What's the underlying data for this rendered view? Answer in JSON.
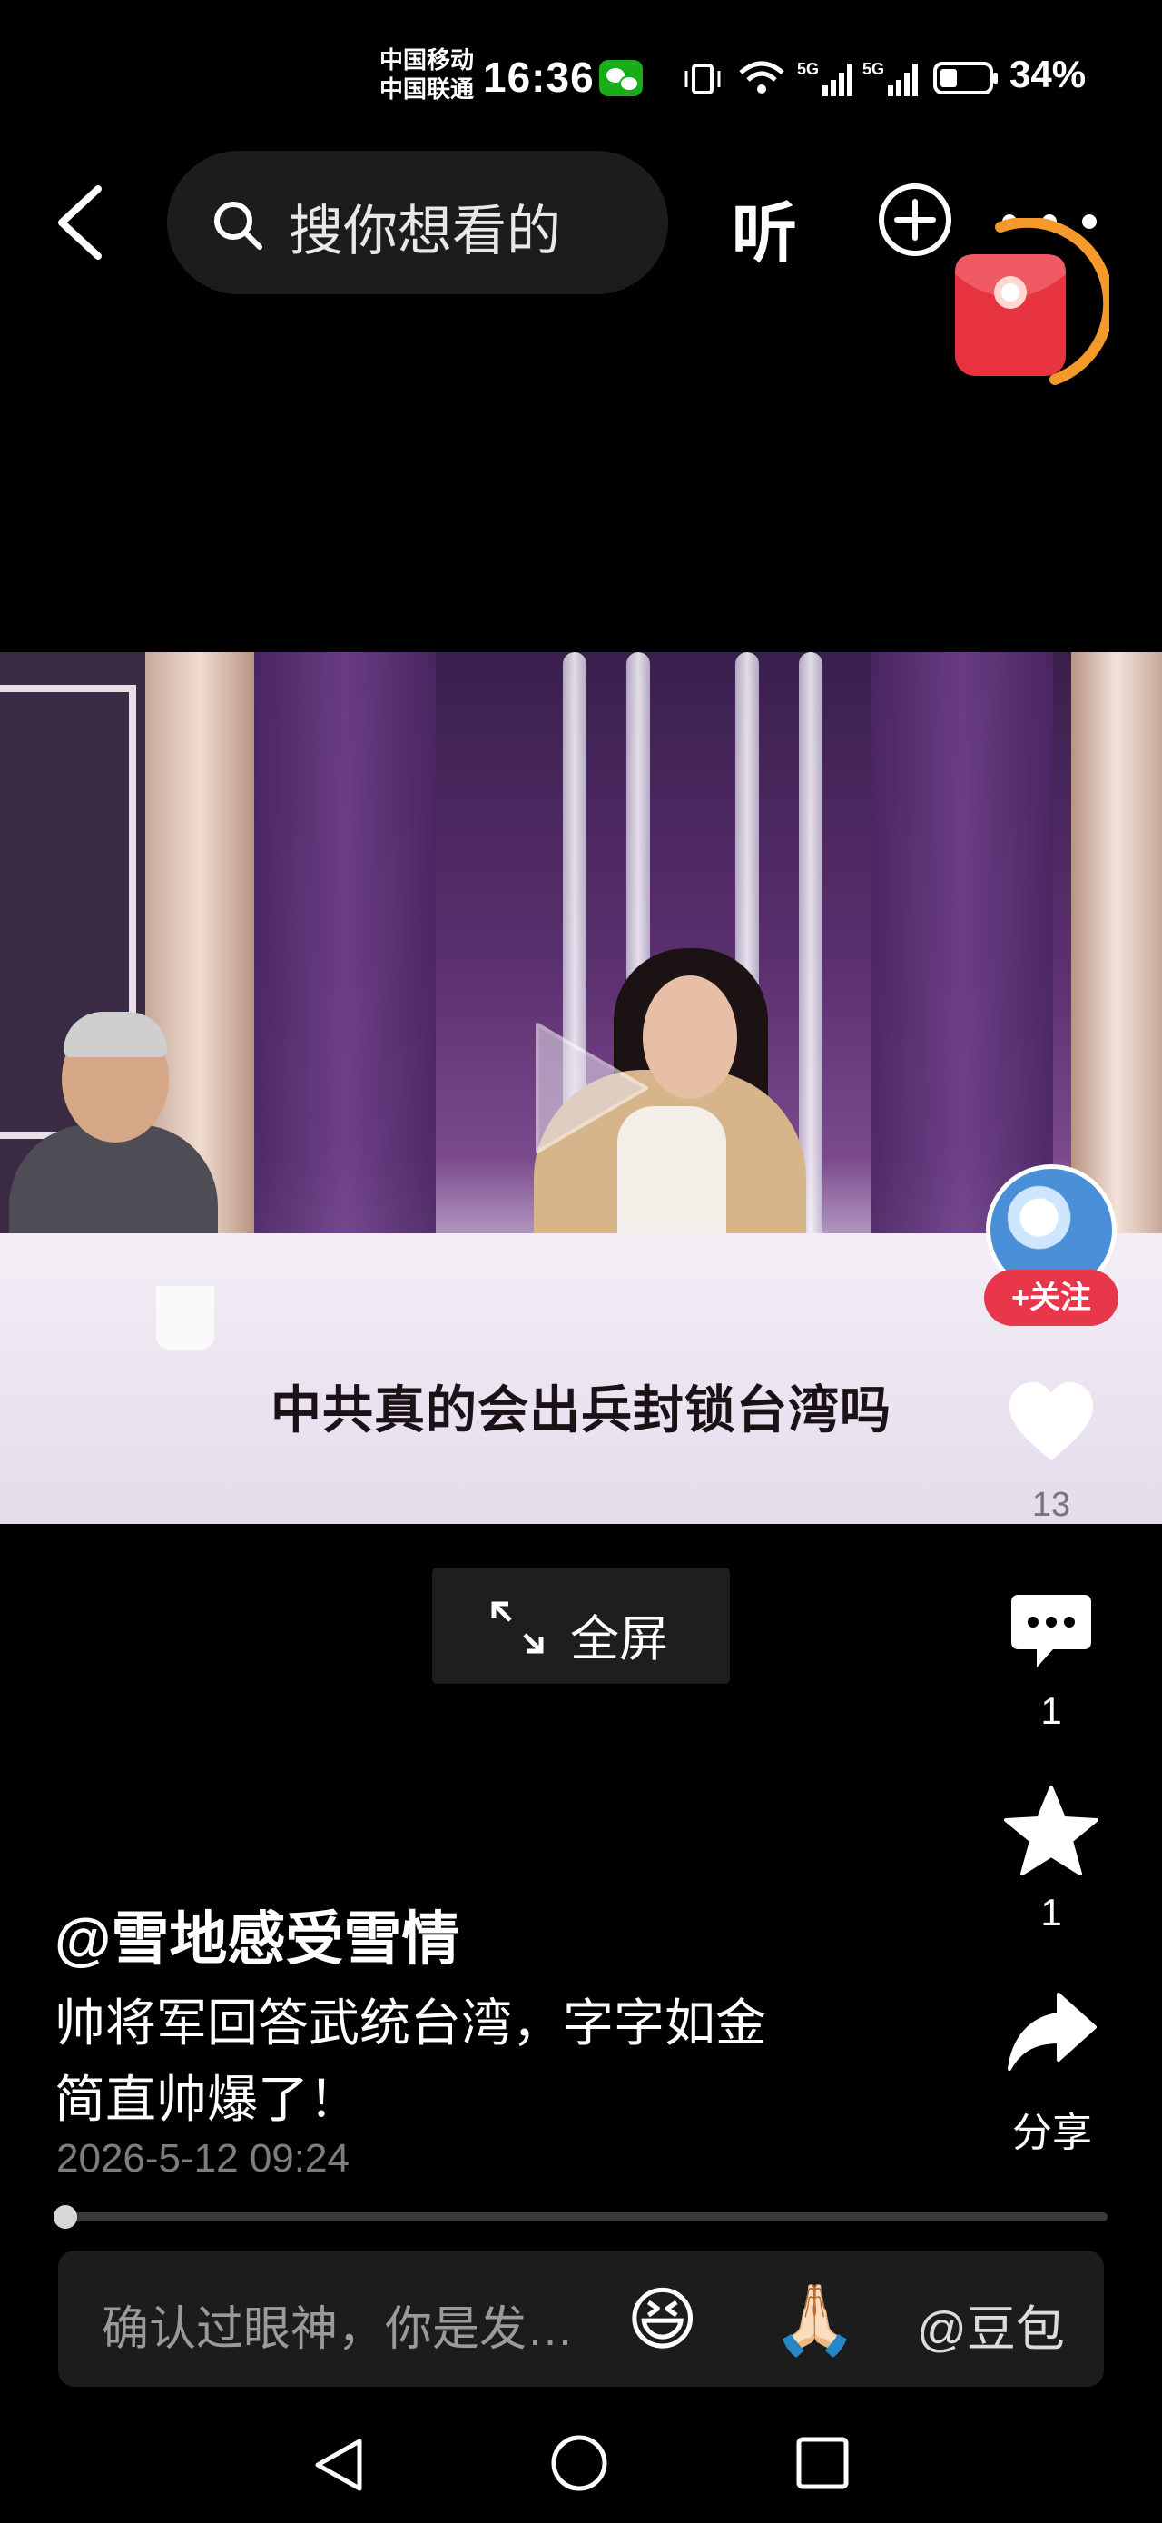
{
  "status_bar": {
    "carrier1": "中国移动",
    "carrier2": "中国联通",
    "time": "16:36",
    "battery": "34%",
    "signal_1": "5G",
    "signal_2": "5G"
  },
  "top_nav": {
    "search_placeholder": "搜你想看的",
    "listen_label": "听"
  },
  "video": {
    "subtitle": "中共真的会出兵封锁台湾吗"
  },
  "fullscreen_label": "全屏",
  "actions": {
    "follow_label": "+关注",
    "like_count": "13",
    "comment_count": "1",
    "favorite_count": "1",
    "share_label": "分享"
  },
  "post": {
    "author": "@雪地感受雪情",
    "description_line1": "帅将军回答武统台湾，字字如金",
    "description_line2": "简直帅爆了！",
    "date": "2026-5-12 09:24",
    "progress_fraction": 0.01
  },
  "comment_bar": {
    "placeholder": "确认过眼神，你是发…",
    "emoji_1": "😆",
    "emoji_2": "🙏🏻",
    "mention": "@豆包"
  },
  "icons": {
    "back": "back-arrow-icon",
    "search": "search-icon",
    "add": "plus-circle-icon",
    "more": "more-dots-icon",
    "red_packet": "red-packet-icon",
    "like": "heart-icon",
    "comment": "comment-bubble-icon",
    "favorite": "star-icon",
    "share": "share-arrow-icon",
    "fullscreen": "expand-icon"
  },
  "colors": {
    "follow_button": "#e8374a",
    "red_packet": "#e73340",
    "timer_ring": "#f39a2b"
  }
}
